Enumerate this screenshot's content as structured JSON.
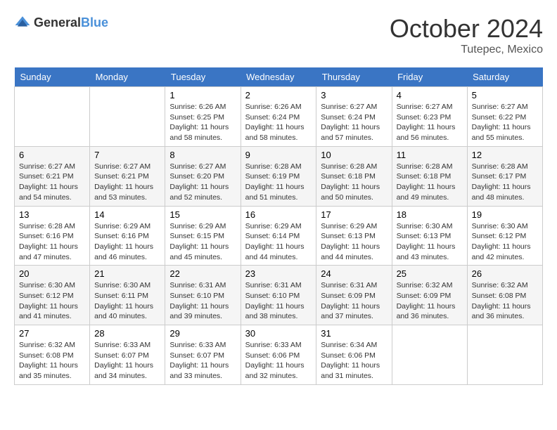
{
  "header": {
    "logo_general": "General",
    "logo_blue": "Blue",
    "month": "October 2024",
    "location": "Tutepec, Mexico"
  },
  "days_of_week": [
    "Sunday",
    "Monday",
    "Tuesday",
    "Wednesday",
    "Thursday",
    "Friday",
    "Saturday"
  ],
  "weeks": [
    [
      {
        "day": "",
        "info": ""
      },
      {
        "day": "",
        "info": ""
      },
      {
        "day": "1",
        "info": "Sunrise: 6:26 AM\nSunset: 6:25 PM\nDaylight: 11 hours and 58 minutes."
      },
      {
        "day": "2",
        "info": "Sunrise: 6:26 AM\nSunset: 6:24 PM\nDaylight: 11 hours and 58 minutes."
      },
      {
        "day": "3",
        "info": "Sunrise: 6:27 AM\nSunset: 6:24 PM\nDaylight: 11 hours and 57 minutes."
      },
      {
        "day": "4",
        "info": "Sunrise: 6:27 AM\nSunset: 6:23 PM\nDaylight: 11 hours and 56 minutes."
      },
      {
        "day": "5",
        "info": "Sunrise: 6:27 AM\nSunset: 6:22 PM\nDaylight: 11 hours and 55 minutes."
      }
    ],
    [
      {
        "day": "6",
        "info": "Sunrise: 6:27 AM\nSunset: 6:21 PM\nDaylight: 11 hours and 54 minutes."
      },
      {
        "day": "7",
        "info": "Sunrise: 6:27 AM\nSunset: 6:21 PM\nDaylight: 11 hours and 53 minutes."
      },
      {
        "day": "8",
        "info": "Sunrise: 6:27 AM\nSunset: 6:20 PM\nDaylight: 11 hours and 52 minutes."
      },
      {
        "day": "9",
        "info": "Sunrise: 6:28 AM\nSunset: 6:19 PM\nDaylight: 11 hours and 51 minutes."
      },
      {
        "day": "10",
        "info": "Sunrise: 6:28 AM\nSunset: 6:18 PM\nDaylight: 11 hours and 50 minutes."
      },
      {
        "day": "11",
        "info": "Sunrise: 6:28 AM\nSunset: 6:18 PM\nDaylight: 11 hours and 49 minutes."
      },
      {
        "day": "12",
        "info": "Sunrise: 6:28 AM\nSunset: 6:17 PM\nDaylight: 11 hours and 48 minutes."
      }
    ],
    [
      {
        "day": "13",
        "info": "Sunrise: 6:28 AM\nSunset: 6:16 PM\nDaylight: 11 hours and 47 minutes."
      },
      {
        "day": "14",
        "info": "Sunrise: 6:29 AM\nSunset: 6:16 PM\nDaylight: 11 hours and 46 minutes."
      },
      {
        "day": "15",
        "info": "Sunrise: 6:29 AM\nSunset: 6:15 PM\nDaylight: 11 hours and 45 minutes."
      },
      {
        "day": "16",
        "info": "Sunrise: 6:29 AM\nSunset: 6:14 PM\nDaylight: 11 hours and 44 minutes."
      },
      {
        "day": "17",
        "info": "Sunrise: 6:29 AM\nSunset: 6:13 PM\nDaylight: 11 hours and 44 minutes."
      },
      {
        "day": "18",
        "info": "Sunrise: 6:30 AM\nSunset: 6:13 PM\nDaylight: 11 hours and 43 minutes."
      },
      {
        "day": "19",
        "info": "Sunrise: 6:30 AM\nSunset: 6:12 PM\nDaylight: 11 hours and 42 minutes."
      }
    ],
    [
      {
        "day": "20",
        "info": "Sunrise: 6:30 AM\nSunset: 6:12 PM\nDaylight: 11 hours and 41 minutes."
      },
      {
        "day": "21",
        "info": "Sunrise: 6:30 AM\nSunset: 6:11 PM\nDaylight: 11 hours and 40 minutes."
      },
      {
        "day": "22",
        "info": "Sunrise: 6:31 AM\nSunset: 6:10 PM\nDaylight: 11 hours and 39 minutes."
      },
      {
        "day": "23",
        "info": "Sunrise: 6:31 AM\nSunset: 6:10 PM\nDaylight: 11 hours and 38 minutes."
      },
      {
        "day": "24",
        "info": "Sunrise: 6:31 AM\nSunset: 6:09 PM\nDaylight: 11 hours and 37 minutes."
      },
      {
        "day": "25",
        "info": "Sunrise: 6:32 AM\nSunset: 6:09 PM\nDaylight: 11 hours and 36 minutes."
      },
      {
        "day": "26",
        "info": "Sunrise: 6:32 AM\nSunset: 6:08 PM\nDaylight: 11 hours and 36 minutes."
      }
    ],
    [
      {
        "day": "27",
        "info": "Sunrise: 6:32 AM\nSunset: 6:08 PM\nDaylight: 11 hours and 35 minutes."
      },
      {
        "day": "28",
        "info": "Sunrise: 6:33 AM\nSunset: 6:07 PM\nDaylight: 11 hours and 34 minutes."
      },
      {
        "day": "29",
        "info": "Sunrise: 6:33 AM\nSunset: 6:07 PM\nDaylight: 11 hours and 33 minutes."
      },
      {
        "day": "30",
        "info": "Sunrise: 6:33 AM\nSunset: 6:06 PM\nDaylight: 11 hours and 32 minutes."
      },
      {
        "day": "31",
        "info": "Sunrise: 6:34 AM\nSunset: 6:06 PM\nDaylight: 11 hours and 31 minutes."
      },
      {
        "day": "",
        "info": ""
      },
      {
        "day": "",
        "info": ""
      }
    ]
  ]
}
